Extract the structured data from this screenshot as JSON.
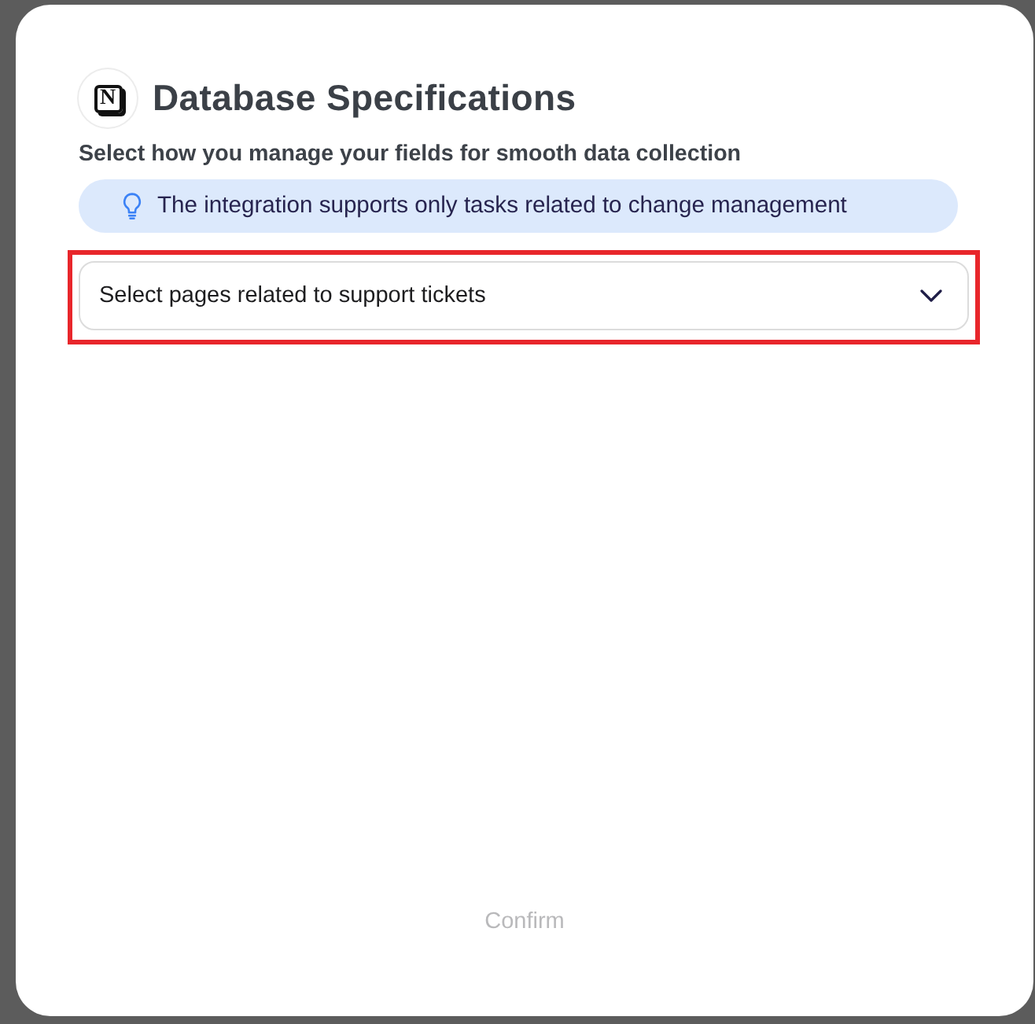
{
  "dialog": {
    "logo": {
      "letter": "N"
    },
    "title": "Database Specifications",
    "subtitle": "Select how you manage your fields for smooth data collection"
  },
  "notice": {
    "text": "The integration supports only tasks related to change management"
  },
  "dropdown": {
    "placeholder": "Select pages related to support tickets",
    "highlighted": true
  },
  "confirm_button": {
    "label": "Confirm",
    "disabled": true
  }
}
